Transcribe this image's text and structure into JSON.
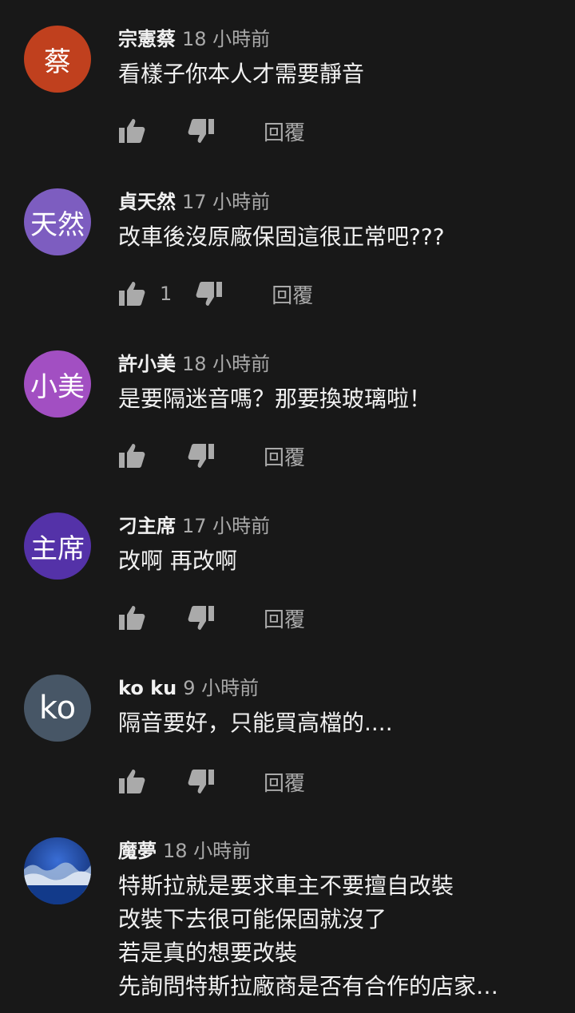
{
  "reply_label": "回覆",
  "colors": {
    "background": "#181818",
    "text": "#f1f1f1",
    "muted": "#aaaaaa"
  },
  "comments": [
    {
      "avatar_text": "蔡",
      "avatar_color": "#c0401e",
      "author": "宗憲蔡",
      "time": "18 小時前",
      "text": "看樣子你本人才需要靜音",
      "like_count": ""
    },
    {
      "avatar_text": "天然",
      "avatar_color": "#7d5dc0",
      "author": "貞天然",
      "time": "17 小時前",
      "text": "改車後沒原廠保固這很正常吧???",
      "like_count": "1"
    },
    {
      "avatar_text": "小美",
      "avatar_color": "#a24fc2",
      "author": "許小美",
      "time": "18 小時前",
      "text": "是要隔迷音嗎？那要換玻璃啦！",
      "like_count": ""
    },
    {
      "avatar_text": "主席",
      "avatar_color": "#5432a8",
      "author": "刁主席",
      "time": "17 小時前",
      "text": "改啊 再改啊",
      "like_count": ""
    },
    {
      "avatar_text": "ko",
      "avatar_color": "#475666",
      "author": "ko ku",
      "time": "9 小時前",
      "text": "隔音要好，只能買高檔的....",
      "like_count": ""
    },
    {
      "avatar_text": "",
      "avatar_color": "#1a3c8c",
      "author": "魔夢",
      "time": "18 小時前",
      "text": "特斯拉就是要求車主不要擅自改裝\n改裝下去很可能保固就沒了\n若是真的想要改裝\n先詢問特斯拉廠商是否有合作的店家…",
      "like_count": ""
    }
  ]
}
